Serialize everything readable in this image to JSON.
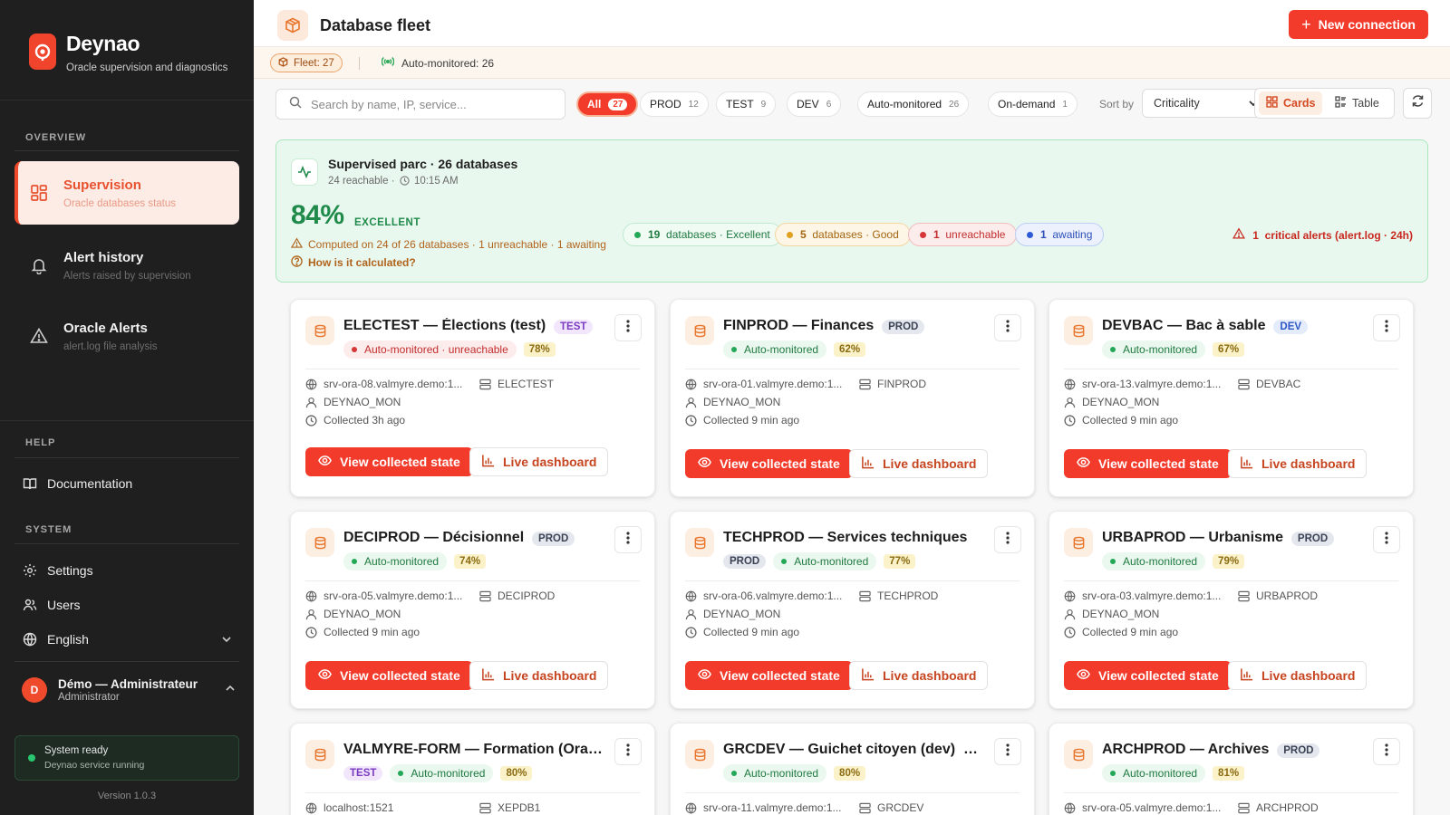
{
  "brand": {
    "name": "Deynao",
    "subtitle": "Oracle supervision and diagnostics"
  },
  "sidebar": {
    "overview_label": "OVERVIEW",
    "nav": [
      {
        "title": "Supervision",
        "subtitle": "Oracle databases status",
        "icon": "grid-icon",
        "active": true
      },
      {
        "title": "Alert history",
        "subtitle": "Alerts raised by supervision",
        "icon": "bell-icon",
        "active": false
      },
      {
        "title": "Oracle Alerts",
        "subtitle": "alert.log file analysis",
        "icon": "warning-icon",
        "active": false
      }
    ],
    "help_label": "HELP",
    "documentation": "Documentation",
    "system_label": "SYSTEM",
    "settings": "Settings",
    "users": "Users",
    "language": "English",
    "user": {
      "initial": "D",
      "name": "Démo — Administrateur",
      "role": "Administrator"
    },
    "system_status": {
      "title": "System ready",
      "subtitle": "Deynao service running"
    },
    "version": "Version 1.0.3"
  },
  "header": {
    "title": "Database fleet",
    "new_button": "New connection",
    "fleet_count": "Fleet: 27",
    "auto_monitored": "Auto-monitored: 26"
  },
  "filters": {
    "search_placeholder": "Search by name, IP, service...",
    "chips": [
      {
        "label": "All",
        "count": "27",
        "active": true
      },
      {
        "label": "PROD",
        "count": "12",
        "active": false
      },
      {
        "label": "TEST",
        "count": "9",
        "active": false
      },
      {
        "label": "DEV",
        "count": "6",
        "active": false
      },
      {
        "label": "Auto-monitored",
        "count": "26",
        "active": false
      },
      {
        "label": "On-demand",
        "count": "1",
        "active": false
      }
    ],
    "sort_label": "Sort by",
    "sort_value": "Criticality",
    "view_cards": "Cards",
    "view_table": "Table"
  },
  "summary": {
    "title": "Supervised parc · 26 databases",
    "reachable": "24 reachable ·",
    "time": "10:15 AM",
    "score": "84%",
    "grade": "EXCELLENT",
    "note": "Computed on 24 of 26 databases · 1 unreachable · 1 awaiting",
    "how": "How is it calculated?",
    "pills": [
      {
        "count": "19",
        "label": "databases · Excellent",
        "tone": "green"
      },
      {
        "count": "5",
        "label": "databases · Good",
        "tone": "amber"
      },
      {
        "count": "1",
        "label": "unreachable",
        "tone": "red"
      },
      {
        "count": "1",
        "label": "awaiting",
        "tone": "blue"
      }
    ],
    "alert_count": "1",
    "alert_label": "critical alerts (alert.log · 24h)",
    "colors": {
      "accent": "#f23b2b",
      "success": "#1f8a4a",
      "warning": "#b0631b"
    }
  },
  "cards": [
    {
      "title": "ELECTEST — Élections (test)",
      "env": "TEST",
      "env_inline": true,
      "monitor": "Auto-monitored · unreachable",
      "status": "bad",
      "score": "78%",
      "host": "srv-ora-08.valmyre.demo:1...",
      "service": "ELECTEST",
      "user": "DEYNAO_MON",
      "collected": "Collected 3h ago"
    },
    {
      "title": "FINPROD — Finances",
      "env": "PROD",
      "env_inline": true,
      "monitor": "Auto-monitored",
      "status": "ok",
      "score": "62%",
      "host": "srv-ora-01.valmyre.demo:1...",
      "service": "FINPROD",
      "user": "DEYNAO_MON",
      "collected": "Collected 9 min ago"
    },
    {
      "title": "DEVBAC — Bac à sable",
      "env": "DEV",
      "env_inline": true,
      "monitor": "Auto-monitored",
      "status": "ok",
      "score": "67%",
      "host": "srv-ora-13.valmyre.demo:1...",
      "service": "DEVBAC",
      "user": "DEYNAO_MON",
      "collected": "Collected 9 min ago"
    },
    {
      "title": "DECIPROD — Décisionnel",
      "env": "PROD",
      "env_inline": true,
      "monitor": "Auto-monitored",
      "status": "ok",
      "score": "74%",
      "host": "srv-ora-05.valmyre.demo:1...",
      "service": "DECIPROD",
      "user": "DEYNAO_MON",
      "collected": "Collected 9 min ago"
    },
    {
      "title": "TECHPROD — Services techniques",
      "env": "PROD",
      "env_inline": false,
      "monitor": "Auto-monitored",
      "status": "ok",
      "score": "77%",
      "host": "srv-ora-06.valmyre.demo:1...",
      "service": "TECHPROD",
      "user": "DEYNAO_MON",
      "collected": "Collected 9 min ago"
    },
    {
      "title": "URBAPROD — Urbanisme",
      "env": "PROD",
      "env_inline": true,
      "monitor": "Auto-monitored",
      "status": "ok",
      "score": "79%",
      "host": "srv-ora-03.valmyre.demo:1...",
      "service": "URBAPROD",
      "user": "DEYNAO_MON",
      "collected": "Collected 9 min ago"
    },
    {
      "title": "VALMYRE-FORM — Formation (Oracle...",
      "env": "TEST",
      "env_inline": false,
      "monitor": "Auto-monitored",
      "status": "ok",
      "score": "80%",
      "host": "localhost:1521",
      "service": "XEPDB1",
      "user": "",
      "collected": ""
    },
    {
      "title": "GRCDEV — Guichet citoyen (dev)",
      "env": "DEV",
      "env_inline": true,
      "monitor": "Auto-monitored",
      "status": "ok",
      "score": "80%",
      "host": "srv-ora-11.valmyre.demo:1...",
      "service": "GRCDEV",
      "user": "",
      "collected": ""
    },
    {
      "title": "ARCHPROD — Archives",
      "env": "PROD",
      "env_inline": true,
      "monitor": "Auto-monitored",
      "status": "ok",
      "score": "81%",
      "host": "srv-ora-05.valmyre.demo:1...",
      "service": "ARCHPROD",
      "user": "",
      "collected": ""
    }
  ],
  "card_actions": {
    "view": "View collected state",
    "live": "Live dashboard"
  }
}
